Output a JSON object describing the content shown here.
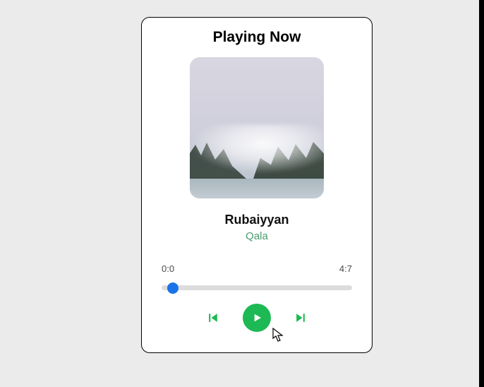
{
  "header": {
    "title": "Playing Now"
  },
  "track": {
    "title": "Rubaiyyan",
    "artist": "Qala"
  },
  "progress": {
    "current_label": "0:0",
    "duration_label": "4:7",
    "value": 3,
    "min": 0,
    "max": 100
  },
  "controls": {
    "previous_icon": "skip-previous-icon",
    "play_icon": "play-icon",
    "next_icon": "skip-next-icon"
  },
  "colors": {
    "accent": "#1db954",
    "slider_thumb": "#1a73e8"
  }
}
